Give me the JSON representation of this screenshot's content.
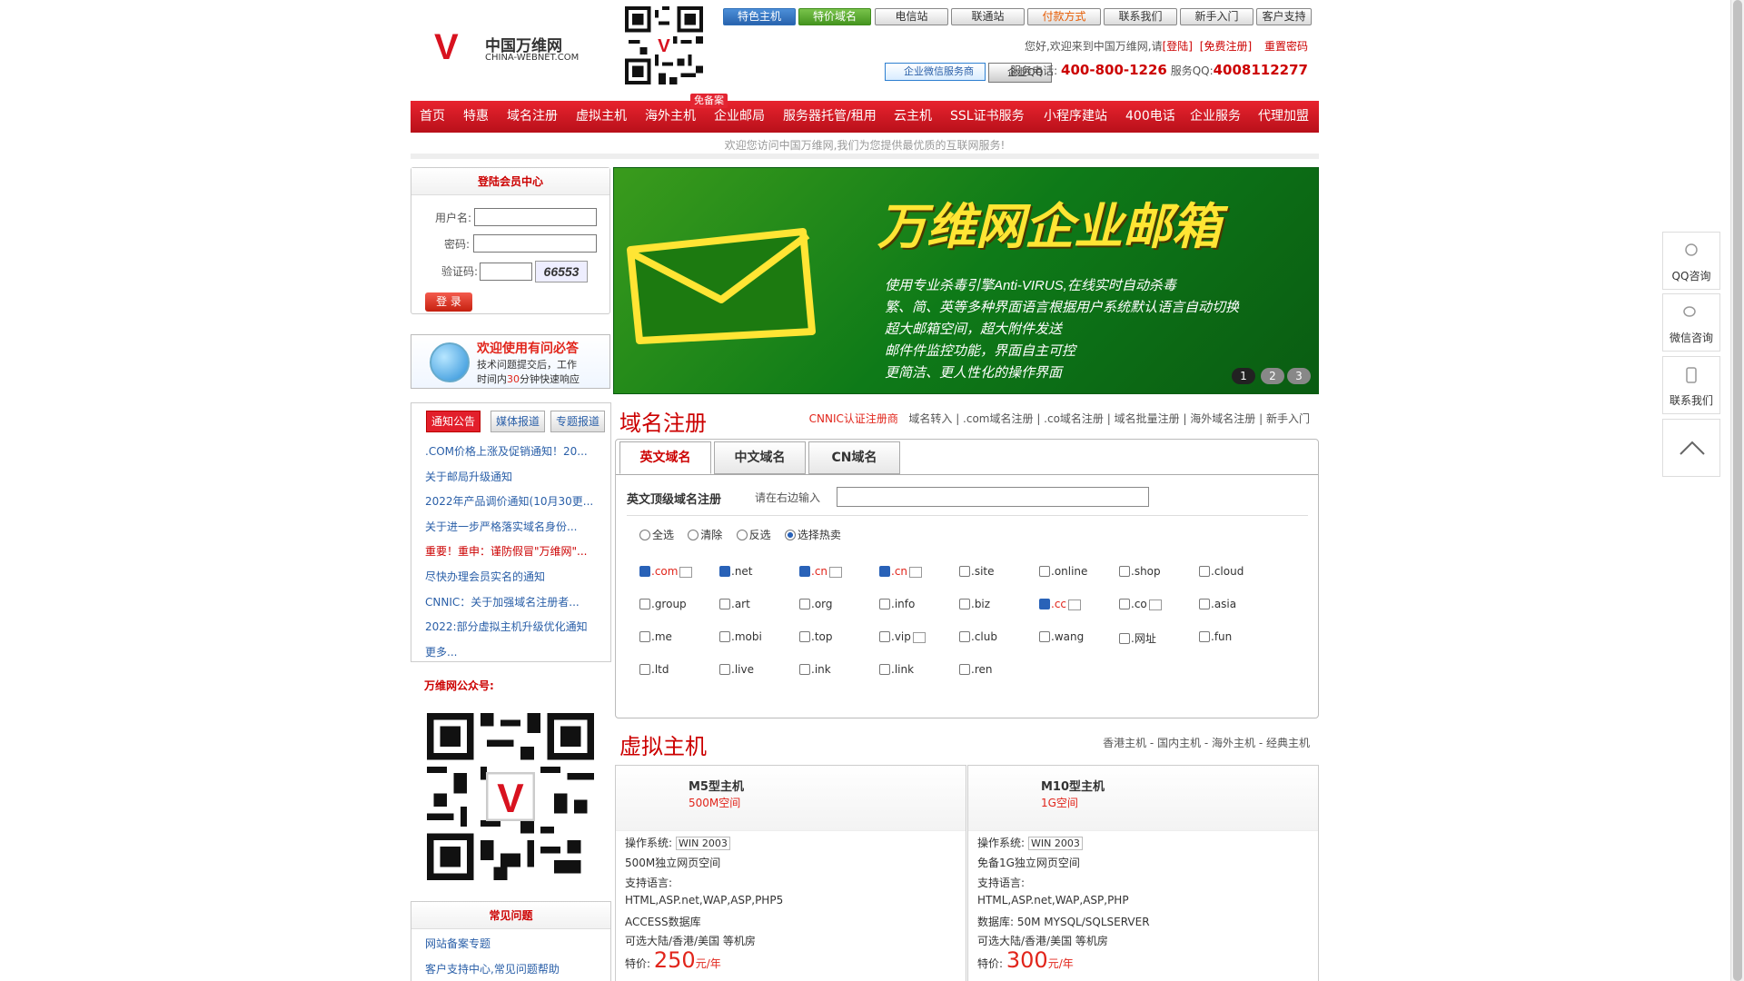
{
  "brand": {
    "mark": "V",
    "cn": "中国万维网",
    "en": "CHINA-WEBNET.COM"
  },
  "topnav": [
    {
      "label": "特色主机",
      "style": "g"
    },
    {
      "label": "特价域名",
      "style": "gr"
    },
    {
      "label": "电信站",
      "style": ""
    },
    {
      "label": "联通站",
      "style": ""
    },
    {
      "label": "付款方式",
      "style": "o"
    },
    {
      "label": "联系我们",
      "style": ""
    },
    {
      "label": "新手入门",
      "style": ""
    },
    {
      "label": "客户支持",
      "style": ""
    }
  ],
  "topinfo": {
    "greeting": "您好,欢迎来到中国万维网,请",
    "login": "[登陆]",
    "register": "[免费注册]",
    "reset": "重置密码"
  },
  "contact": {
    "wechat": "企业微信服务商",
    "qq_btn": "企业QQ",
    "phone_label": "服务电话:",
    "phone": "400-800-1226",
    "qq_label": "服务QQ:",
    "qq": "4008112277"
  },
  "mainnav": [
    "首页",
    "特惠",
    "域名注册",
    "虚拟主机",
    "海外主机",
    "企业邮局",
    "服务器托管/租用",
    "云主机",
    "SSL证书服务",
    "小程序建站",
    "400电话",
    "企业服务",
    "代理加盟"
  ],
  "beian_badge": "免备案",
  "welcome": "欢迎您访问中国万维网,我们为您提供最优质的互联网服务!",
  "login": {
    "title": "登陆会员中心",
    "user_label": "用户名:",
    "pass_label": "密码:",
    "code_label": "验证码:",
    "captcha": "66553",
    "submit": "登 录"
  },
  "help": {
    "title": "欢迎使用有问必答",
    "line1": "技术问题提交后，工作",
    "line2a": "时间内",
    "line2b": "30",
    "line2c": "分钟快速响应"
  },
  "news": {
    "tabs": [
      "通知公告",
      "媒体报道",
      "专题报道"
    ],
    "items": [
      ".COM价格上涨及促销通知！20...",
      "关于邮局升级通知",
      "2022年产品调价通知(10月30更...",
      "关于进一步严格落实域名身份...",
      "重要！重申：谨防假冒\"万维网\"...",
      "尽快办理会员实名的通知",
      "CNNIC：关于加强域名注册者...",
      "2022:部分虚拟主机升级优化通知",
      "更多..."
    ]
  },
  "wx_label": "万维网公众号:",
  "faq": {
    "title": "常见问题",
    "items": [
      "网站备案专题",
      "客户支持中心,常见问题帮助"
    ]
  },
  "banner": {
    "title": "万维网企业邮箱",
    "lines": [
      "使用专业杀毒引擎Anti-VIRUS,在线实时自动杀毒",
      "繁、简、英等多种界面语言根据用户系统默认语言自动切换",
      "超大邮箱空间，超大附件发送",
      "邮件件监控功能，界面自主可控",
      "更简洁、更人性化的操作界面"
    ],
    "pages": [
      "1",
      "2",
      "3"
    ]
  },
  "domain": {
    "title": "域名注册",
    "links": {
      "cnnic": "CNNIC认证注册商",
      "transfer": "域名转入",
      "com": ".com域名注册",
      "co": ".co域名注册",
      "batch": "域名批量注册",
      "overseas": "海外域名注册",
      "newbie": "新手入门"
    },
    "tabs": [
      "英文域名",
      "中文域名",
      "CN域名"
    ],
    "label": "英文顶级域名注册",
    "hint": "请在右边输入",
    "radios": [
      "全选",
      "清除",
      "反选",
      "选择热卖"
    ],
    "exts": [
      {
        "name": ".com",
        "checked": true,
        "hot": true
      },
      {
        "name": ".net",
        "checked": true,
        "hot": false
      },
      {
        "name": ".cn",
        "checked": true,
        "hot": true
      },
      {
        "name": ".cn",
        "checked": true,
        "hot": true
      },
      {
        "name": ".site",
        "checked": false,
        "hot": false
      },
      {
        "name": ".online",
        "checked": false,
        "hot": false
      },
      {
        "name": ".shop",
        "checked": false,
        "hot": false
      },
      {
        "name": ".cloud",
        "checked": false,
        "hot": false
      },
      {
        "name": ".group",
        "checked": false,
        "hot": false
      },
      {
        "name": ".art",
        "checked": false,
        "hot": false
      },
      {
        "name": ".org",
        "checked": false,
        "hot": false
      },
      {
        "name": ".info",
        "checked": false,
        "hot": false
      },
      {
        "name": ".biz",
        "checked": false,
        "hot": false
      },
      {
        "name": ".cc",
        "checked": true,
        "hot": true
      },
      {
        "name": ".co",
        "checked": false,
        "hot": true
      },
      {
        "name": ".asia",
        "checked": false,
        "hot": false
      },
      {
        "name": ".me",
        "checked": false,
        "hot": false
      },
      {
        "name": ".mobi",
        "checked": false,
        "hot": false
      },
      {
        "name": ".top",
        "checked": false,
        "hot": false
      },
      {
        "name": ".vip",
        "checked": false,
        "hot": true
      },
      {
        "name": ".club",
        "checked": false,
        "hot": false
      },
      {
        "name": ".wang",
        "checked": false,
        "hot": false
      },
      {
        "name": ".网址",
        "checked": false,
        "hot": false
      },
      {
        "name": ".fun",
        "checked": false,
        "hot": false
      },
      {
        "name": ".ltd",
        "checked": false,
        "hot": false
      },
      {
        "name": ".live",
        "checked": false,
        "hot": false
      },
      {
        "name": ".ink",
        "checked": false,
        "hot": false
      },
      {
        "name": ".link",
        "checked": false,
        "hot": false
      },
      {
        "name": ".ren",
        "checked": false,
        "hot": false
      }
    ]
  },
  "hosting": {
    "title": "虚拟主机",
    "links": "香港主机 - 国内主机 - 海外主机 - 经典主机",
    "plans": [
      {
        "name": "M5型主机",
        "space": "500M空间",
        "os_label": "操作系统:",
        "os": "WIN 2003",
        "rows": [
          "500M独立网页空间",
          "支持语言:",
          "HTML,ASP.net,WAP,ASP,PHP5",
          "ACCESS数据库",
          "可选大陆/香港/美国 等机房"
        ],
        "price_label": "特价:",
        "price": "250",
        "unit": "元/年"
      },
      {
        "name": "M10型主机",
        "space": "1G空间",
        "os_label": "操作系统:",
        "os": "WIN 2003",
        "rows": [
          "免备1G独立网页空间",
          "支持语言:",
          "HTML,ASP.net,WAP,ASP,PHP",
          "数据库: 50M MYSQL/SQLSERVER",
          "可选大陆/香港/美国 等机房"
        ],
        "price_label": "特价:",
        "price": "300",
        "unit": "元/年"
      }
    ]
  },
  "float": [
    "QQ咨询",
    "微信咨询",
    "联系我们"
  ],
  "colors": {
    "brand_red": "#d8121f",
    "nav_red": "#c4141e",
    "link_blue": "#2a5fa8",
    "banner_green": "#0e7a18",
    "banner_yellow": "#ffe534"
  }
}
